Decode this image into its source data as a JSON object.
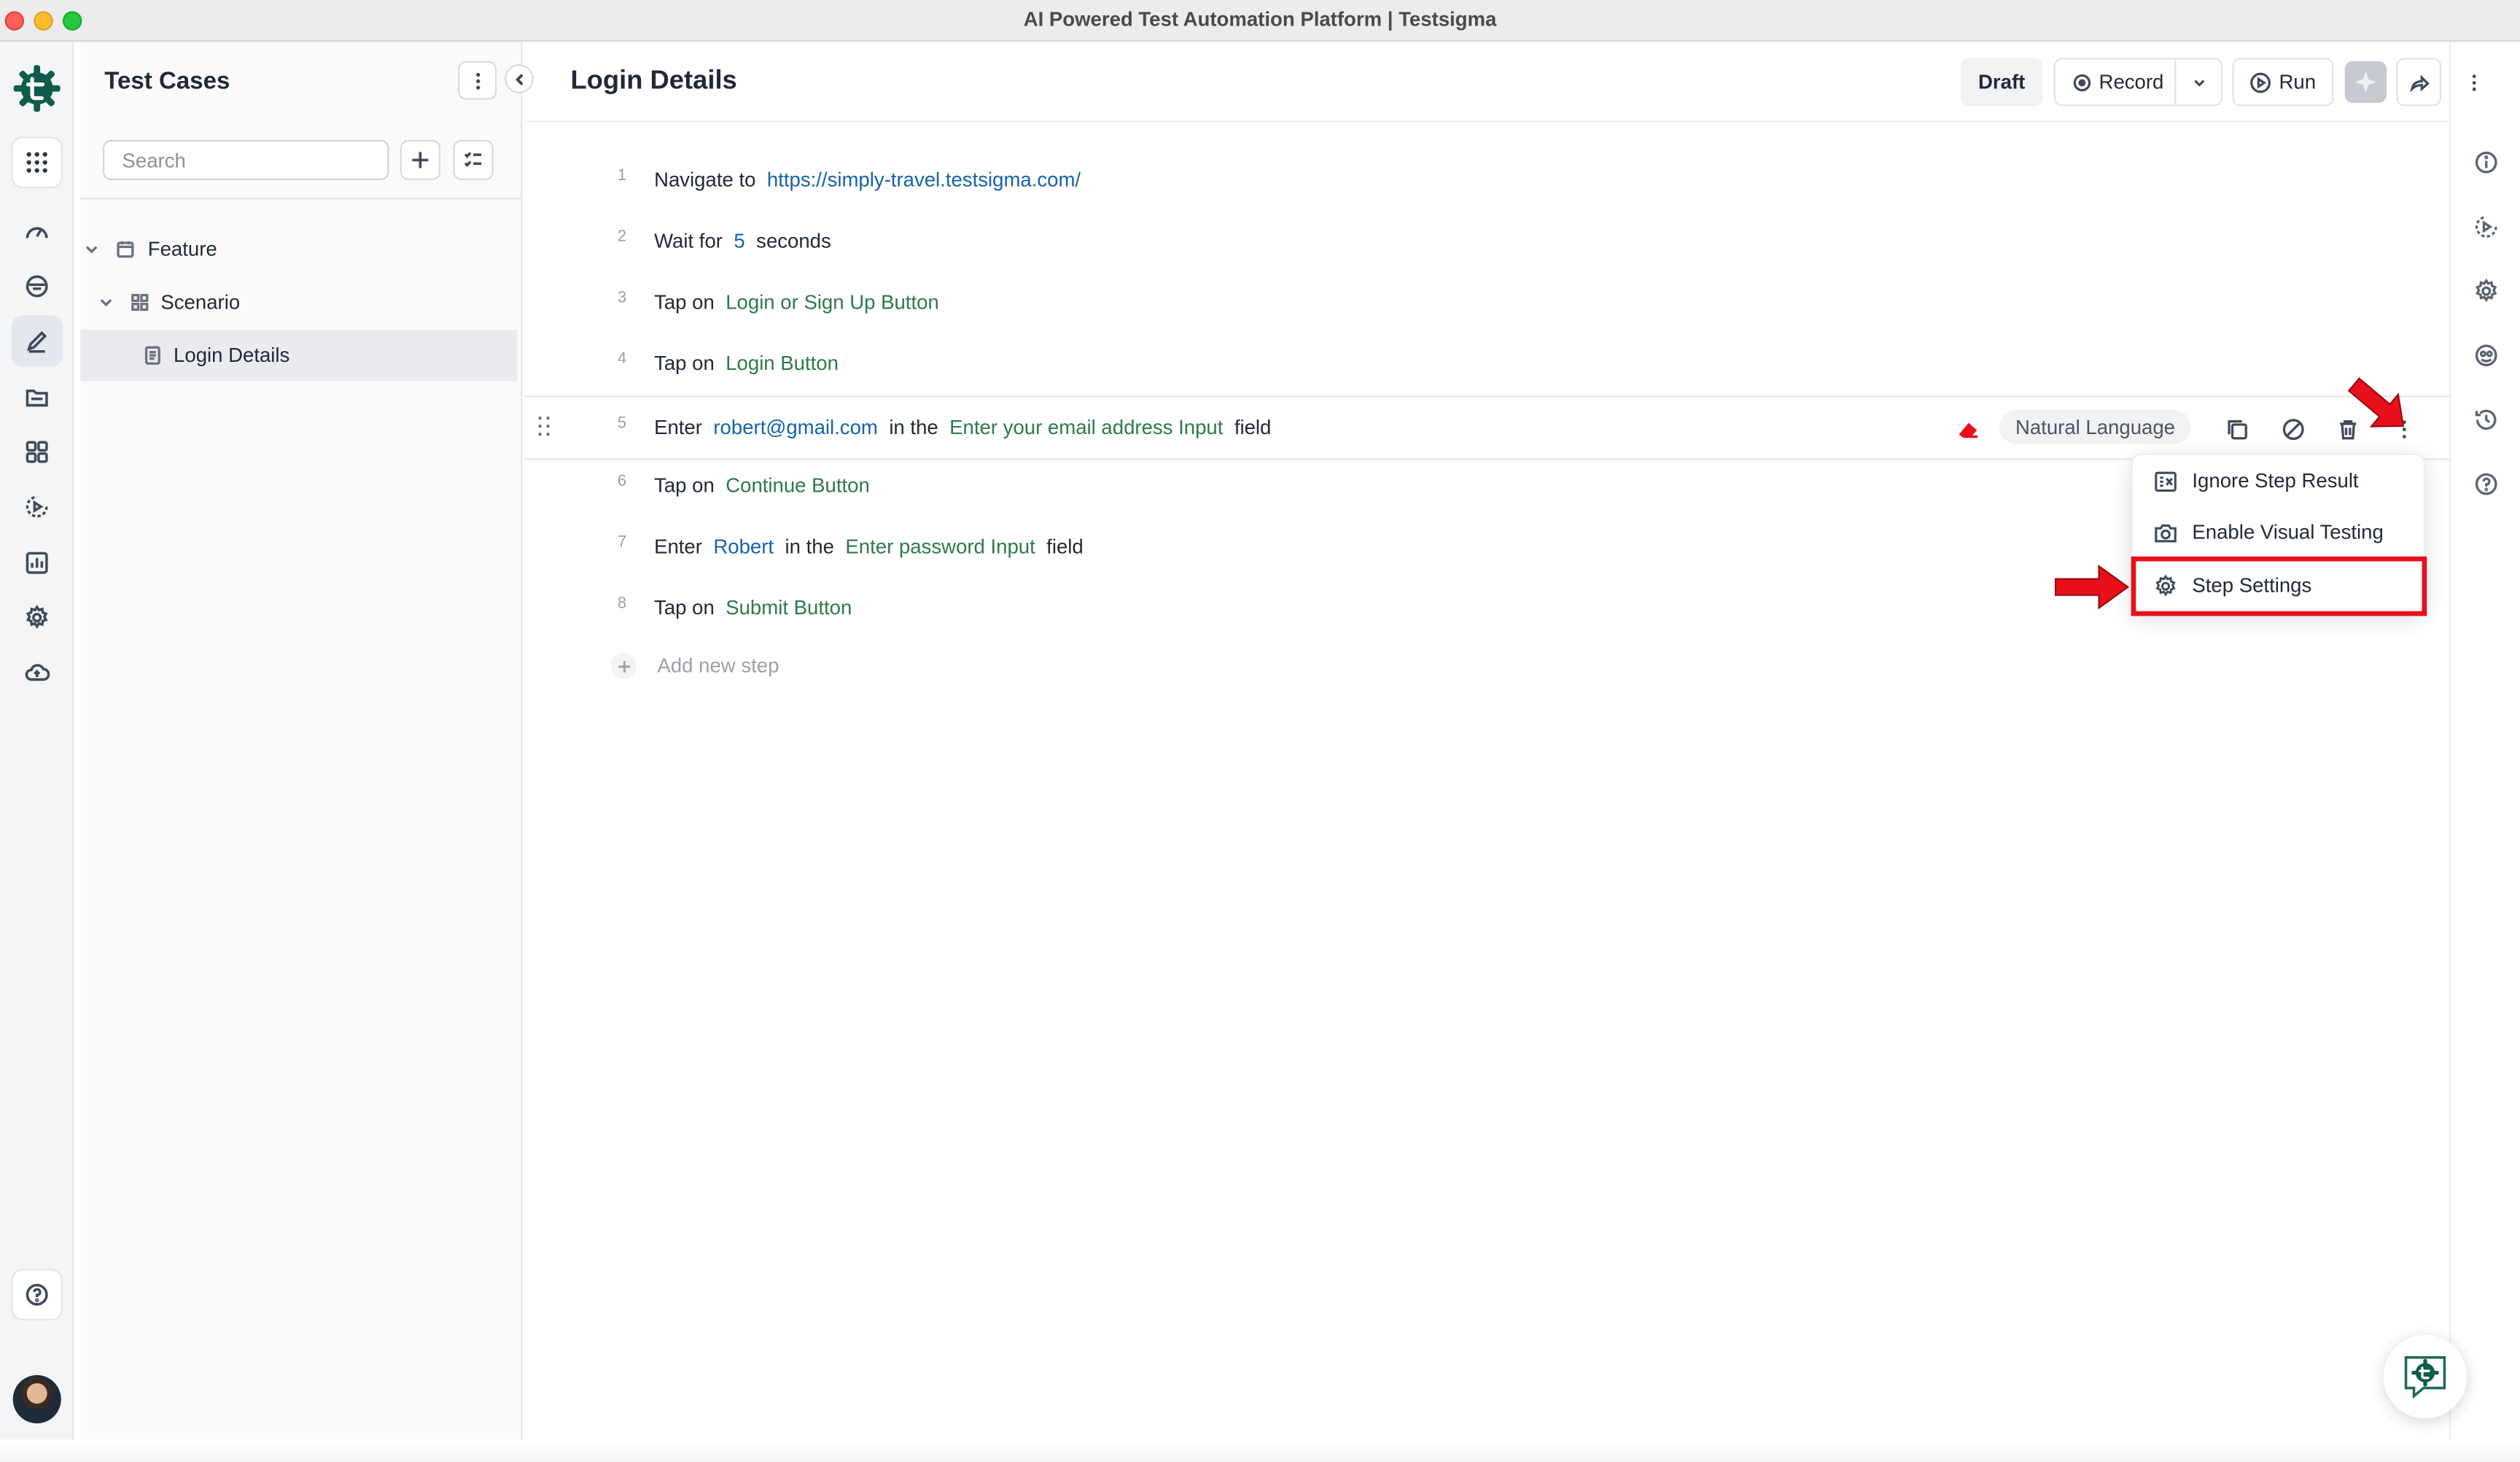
{
  "window": {
    "title": "AI Powered Test Automation Platform | Testsigma"
  },
  "sidebar_panel": {
    "title": "Test Cases",
    "search_placeholder": "Search",
    "tree": [
      {
        "label": "Feature",
        "type": "feature"
      },
      {
        "label": "Scenario",
        "type": "scenario"
      },
      {
        "label": "Login Details",
        "type": "test-case",
        "selected": true
      }
    ]
  },
  "header": {
    "title": "Login Details",
    "draft_label": "Draft",
    "record_label": "Record",
    "run_label": "Run"
  },
  "steps": [
    {
      "num": "1",
      "parts": [
        [
          "kw",
          "Navigate to"
        ],
        [
          "blue",
          "https://simply-travel.testsigma.com/"
        ]
      ]
    },
    {
      "num": "2",
      "parts": [
        [
          "kw",
          "Wait for"
        ],
        [
          "blue",
          "5"
        ],
        [
          "kw",
          "seconds"
        ]
      ]
    },
    {
      "num": "3",
      "parts": [
        [
          "kw",
          "Tap on"
        ],
        [
          "green",
          "Login or Sign Up Button"
        ]
      ]
    },
    {
      "num": "4",
      "parts": [
        [
          "kw",
          "Tap on"
        ],
        [
          "green",
          "Login Button"
        ]
      ]
    },
    {
      "num": "5",
      "parts": [
        [
          "kw",
          "Enter"
        ],
        [
          "blue",
          "robert@gmail.com"
        ],
        [
          "kw",
          "in the"
        ],
        [
          "green",
          "Enter your email address Input"
        ],
        [
          "kw",
          "field"
        ]
      ]
    },
    {
      "num": "6",
      "parts": [
        [
          "kw",
          "Tap on"
        ],
        [
          "green",
          "Continue Button"
        ]
      ]
    },
    {
      "num": "7",
      "parts": [
        [
          "kw",
          "Enter"
        ],
        [
          "blue",
          "Robert"
        ],
        [
          "kw",
          "in the"
        ],
        [
          "green",
          "Enter password Input"
        ],
        [
          "kw",
          "field"
        ]
      ]
    },
    {
      "num": "8",
      "parts": [
        [
          "kw",
          "Tap on"
        ],
        [
          "green",
          "Submit Button"
        ]
      ]
    }
  ],
  "hovered_step": {
    "language_chip": "Natural Language"
  },
  "add_step_label": "Add new step",
  "step_menu": {
    "items": [
      {
        "label": "Ignore Step Result",
        "icon": "ignore-result-icon"
      },
      {
        "label": "Enable Visual Testing",
        "icon": "camera-icon"
      },
      {
        "label": "Step Settings",
        "icon": "gear-icon",
        "highlighted": true
      }
    ]
  },
  "colors": {
    "value_blue": "#1663a8",
    "element_green": "#2d7a4a",
    "annotation_red": "#e8101a",
    "brand_teal": "#0f5c4a"
  }
}
